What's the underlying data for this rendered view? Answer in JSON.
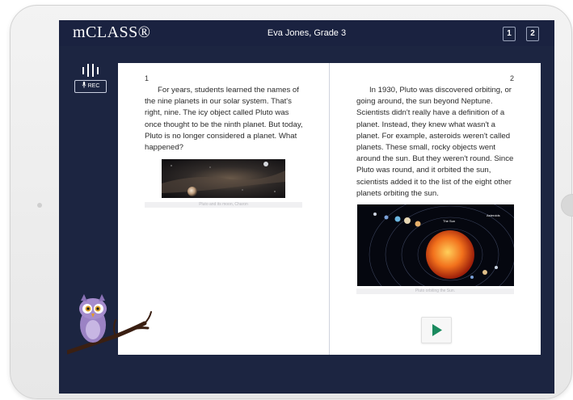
{
  "app": {
    "logo": "mCLASS®",
    "student": "Eva Jones, Grade 3",
    "page_buttons": [
      "1",
      "2"
    ]
  },
  "toolbar": {
    "rec_label": "REC",
    "audio_icon": "audio-bars-icon",
    "mic_icon": "microphone-icon"
  },
  "book": {
    "left": {
      "page_number": "1",
      "text": "For years, students learned the names of the nine planets in our solar system. That's right, nine. The icy object called Pluto was once thought to be the ninth planet. But today, Pluto is no longer considered a planet. What happened?",
      "caption": "Pluto and its moon, Charon"
    },
    "right": {
      "page_number": "2",
      "text": "In 1930, Pluto was discovered orbiting, or going around, the sun beyond Neptune. Scientists didn't really have a definition of a planet. Instead, they knew what wasn't a planet. For example, asteroids weren't called planets. These small, rocky objects went around the sun. But they weren't round. Since Pluto was round, and it orbited the sun, scientists added it to the list of the eight other planets orbiting the sun.",
      "caption": "Pluto orbiting the Sun.",
      "diagram_labels": {
        "sun": "The Sun",
        "asteroids": "Asteroids"
      }
    }
  },
  "play_icon": "play-icon",
  "colors": {
    "screen_bg": "#1c2541",
    "play_green": "#1a8a5e",
    "book_page": "#ffffff"
  }
}
